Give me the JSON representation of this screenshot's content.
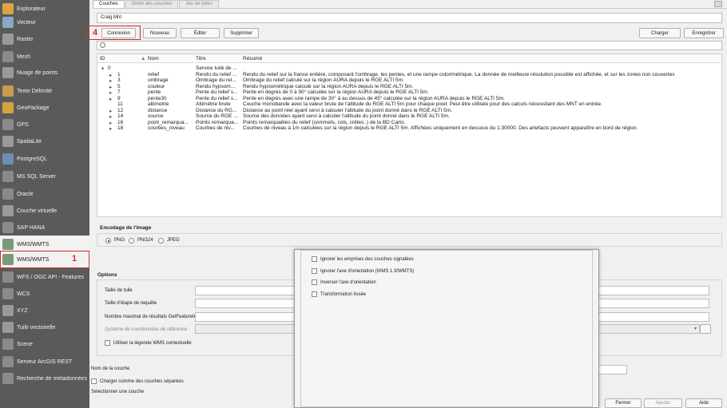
{
  "sidebar": {
    "items": [
      {
        "label": "Explorateur",
        "icon": "explorer-icon",
        "color": "#d9a441"
      },
      {
        "label": "Vecteur",
        "icon": "vector-icon",
        "color": "#8aa8c8"
      },
      {
        "label": "Raster",
        "icon": "raster-icon",
        "color": "#9a9a9a"
      },
      {
        "label": "Mesh",
        "icon": "mesh-icon",
        "color": "#8a8a8a"
      },
      {
        "label": "Nuage de points",
        "icon": "point-cloud-icon",
        "color": "#9a9a9a"
      },
      {
        "label": "Texte Délimité",
        "icon": "delimited-text-icon",
        "color": "#c89a52"
      },
      {
        "label": "GeoPackage",
        "icon": "geopackage-icon",
        "color": "#d6a23a"
      },
      {
        "label": "GPS",
        "icon": "gps-icon",
        "color": "#8a8a8a"
      },
      {
        "label": "SpatiaLite",
        "icon": "spatialite-icon",
        "color": "#9a9a9a"
      },
      {
        "label": "PostgreSQL",
        "icon": "postgresql-icon",
        "color": "#6c8fb0"
      },
      {
        "label": "MS SQL Server",
        "icon": "mssql-icon",
        "color": "#8a8a8a"
      },
      {
        "label": "Oracle",
        "icon": "oracle-icon",
        "color": "#8a8a8a"
      },
      {
        "label": "Couche virtuelle",
        "icon": "virtual-layer-icon",
        "color": "#9a9a9a"
      },
      {
        "label": "SAP HANA",
        "icon": "sap-hana-icon",
        "color": "#8a8a8a"
      },
      {
        "label": "WMS/WMTS",
        "icon": "globe-icon",
        "color": "#7a9a7a"
      },
      {
        "label": "WMS/WMTS",
        "icon": "globe-icon",
        "color": "#7a9a7a"
      },
      {
        "label": "WFS / OGC API - Features",
        "icon": "wfs-icon",
        "color": "#8a8a8a"
      },
      {
        "label": "WCS",
        "icon": "wcs-icon",
        "color": "#8a8a8a"
      },
      {
        "label": "XYZ",
        "icon": "xyz-icon",
        "color": "#9a9a9a"
      },
      {
        "label": "Tuile vectorielle",
        "icon": "vector-tile-icon",
        "color": "#9a9a9a"
      },
      {
        "label": "Scene",
        "icon": "scene-icon",
        "color": "#8a8a8a"
      },
      {
        "label": "Serveur ArcGIS REST",
        "icon": "arcgis-icon",
        "color": "#8a8a8a"
      },
      {
        "label": "Recherche de métadonnées",
        "icon": "metadata-search-icon",
        "color": "#8a8a8a"
      }
    ]
  },
  "markers": {
    "sidebar": "1",
    "connect": "4"
  },
  "tabs": [
    "Couches",
    "Ordre des couches",
    "Jeu de tuiles"
  ],
  "connection": {
    "selected": "Craig Mnt"
  },
  "buttons": {
    "connect": "Connexion",
    "new": "Nouveau",
    "edit": "Éditer",
    "delete": "Supprimer",
    "load": "Charger",
    "save": "Enregistrer"
  },
  "table": {
    "headers": {
      "id": "ID",
      "name": "Nom",
      "title": "Titre",
      "summary": "Résumé"
    },
    "rows": [
      {
        "id": "0",
        "name": "",
        "title": "Service tuilé de ...",
        "summary": ""
      },
      {
        "id": "1",
        "name": "relief",
        "title": "Rendu du relief ...",
        "summary": "Rendu du relief sur la france entière, composant l'ombrage, les pentes, et une rampe colorimétrique. La donnée de meilleure résolution possible est affichée, et sur les zones non couvertes"
      },
      {
        "id": "3",
        "name": "ombrage",
        "title": "Ombrage du rel...",
        "summary": "Ombrage du relief calculé sur la région AURA depuis le RGE ALTI 5m."
      },
      {
        "id": "5",
        "name": "couleur",
        "title": "Rendu hypsom...",
        "summary": "Rendu hypsométrique calculé sur la région AURA depuis le RGE ALTI 5m."
      },
      {
        "id": "7",
        "name": "pente",
        "title": "Pente du relief s...",
        "summary": "Pente en degrés de 0 à 90° calculée sur la région AURA depuis le RGE ALTI 5m."
      },
      {
        "id": "9",
        "name": "pente30",
        "title": "Pente du relief s...",
        "summary": "Pente en degrés avec une rampe de 30° à au dessus de 45° calculée sur la région AURA depuis le RGE ALTI 5m."
      },
      {
        "id": "11",
        "name": "altimetrie",
        "title": "Altimétrie brute",
        "summary": "Couche monobande avec la valeur brute de l'altitude du RGE ALTI 5m pour chaque pixel. Peut être utilisée pour des calculs nécessitant des MNT en entrée."
      },
      {
        "id": "12",
        "name": "distance",
        "title": "Distance du RG...",
        "summary": "Distance au point réel ayant servi à calculer l'altitude du point donné dans le RGE ALTI 5m."
      },
      {
        "id": "14",
        "name": "source",
        "title": "Source du RGE ...",
        "summary": "Source des données ayant servi à calculer l'altitude du point donné dans le RGE ALTI 5m."
      },
      {
        "id": "16",
        "name": "point_remarqua...",
        "title": "Points remarqua...",
        "summary": "Points remarquables du relief (sommets, cols, crêtes..) de la BD Carto."
      },
      {
        "id": "18",
        "name": "courbes_niveau",
        "title": "Courbes de niv...",
        "summary": "Courbes de niveau à 1m calculées sur la région depuis le RGE ALTI 5m. Affichées uniquement en dessous du 1:30000. Des artefacts peuvent apparaître en bord de région."
      }
    ]
  },
  "encoding": {
    "title": "Encodage de l'image",
    "options": [
      "PNG",
      "PNG24",
      "JPEG"
    ]
  },
  "options": {
    "title": "Options",
    "tile_size": "Taille de tuile",
    "request_step": "Taille d'étape de requête",
    "max_results": "Nombre maximal de résultats GetFeatureInfo",
    "crs": "Système de coordonnées de référence",
    "legend": "Utiliser la légende WMS contextuelle"
  },
  "popup": {
    "items": [
      "Ignorer les emprises des couches signalées",
      "Ignorer l'axe d'orientation (WMS 1.3/WMTS)",
      "Inverser l'axe d'orientation",
      "Transformation lissée"
    ]
  },
  "bottom": {
    "layer_name": "Nom de la couche",
    "separate": "Charger comme des couches séparées",
    "select": "Sélectionner une couche"
  },
  "footer": {
    "close": "Fermer",
    "add": "Ajouter",
    "help": "Aide"
  }
}
